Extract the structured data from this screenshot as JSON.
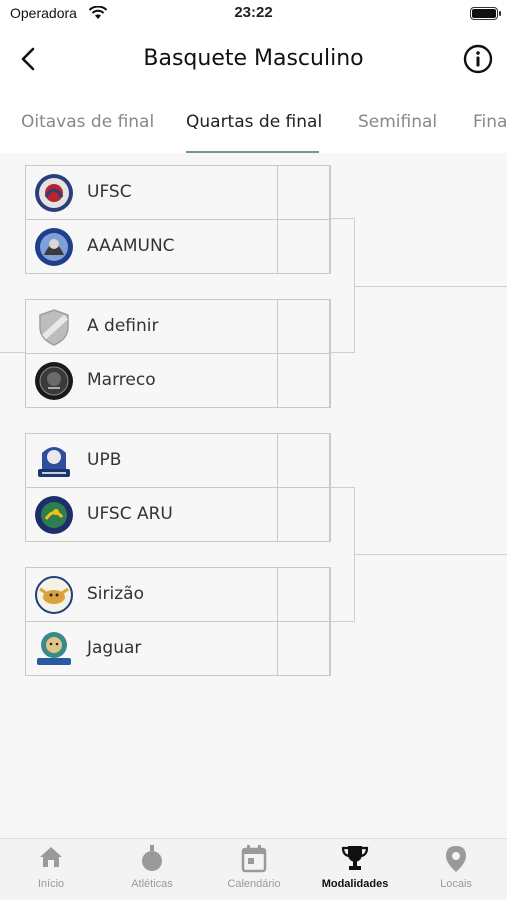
{
  "status_bar": {
    "carrier": "Operadora",
    "time": "23:22"
  },
  "header": {
    "title": "Basquete Masculino"
  },
  "tabs": [
    {
      "label": "Oitavas de final",
      "active": false
    },
    {
      "label": "Quartas de final",
      "active": true
    },
    {
      "label": "Semifinal",
      "active": false
    },
    {
      "label": "Final",
      "active": false
    }
  ],
  "matches": [
    {
      "teams": [
        {
          "name": "UFSC",
          "logo": "ufsc-logo-icon"
        },
        {
          "name": "AAAMUNC",
          "logo": "aaamunc-logo-icon"
        }
      ]
    },
    {
      "teams": [
        {
          "name": "A definir",
          "logo": "shield-placeholder-icon"
        },
        {
          "name": "Marreco",
          "logo": "marreco-logo-icon"
        }
      ]
    },
    {
      "teams": [
        {
          "name": "UPB",
          "logo": "upb-logo-icon"
        },
        {
          "name": "UFSC ARU",
          "logo": "ufsc-aru-logo-icon"
        }
      ]
    },
    {
      "teams": [
        {
          "name": "Sirizão",
          "logo": "sirizao-logo-icon"
        },
        {
          "name": "Jaguar",
          "logo": "jaguar-logo-icon"
        }
      ]
    }
  ],
  "tab_bar": {
    "items": [
      {
        "label": "Início",
        "icon": "home-icon"
      },
      {
        "label": "Atléticas",
        "icon": "medal-icon"
      },
      {
        "label": "Calendário",
        "icon": "calendar-icon"
      },
      {
        "label": "Modalidades",
        "icon": "trophy-icon",
        "active": true
      },
      {
        "label": "Locais",
        "icon": "location-pin-icon"
      }
    ]
  },
  "colors": {
    "accent": "#6e9a8f",
    "border": "#c9c9c9",
    "background": "#f7f7f7"
  }
}
